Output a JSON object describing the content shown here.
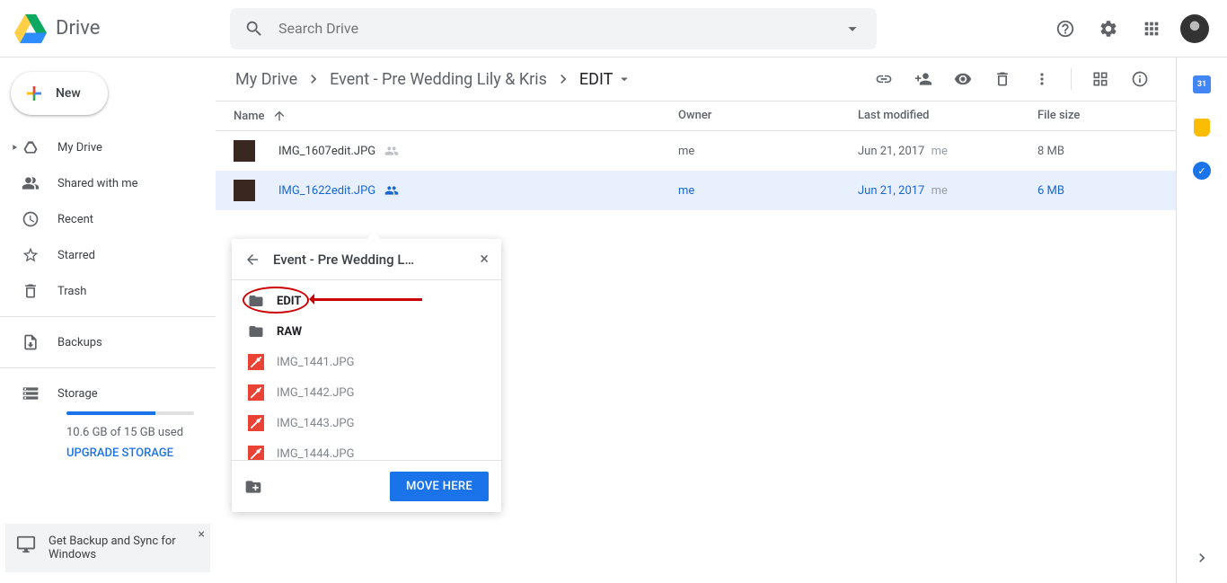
{
  "header": {
    "app_title": "Drive",
    "search_placeholder": "Search Drive"
  },
  "new_button": {
    "label": "New"
  },
  "sidebar": {
    "items": [
      {
        "label": "My Drive"
      },
      {
        "label": "Shared with me"
      },
      {
        "label": "Recent"
      },
      {
        "label": "Starred"
      },
      {
        "label": "Trash"
      }
    ],
    "backups_label": "Backups",
    "storage": {
      "label": "Storage",
      "used_text": "10.6 GB of 15 GB used",
      "upgrade_label": "UPGRADE STORAGE"
    },
    "promo_text": "Get Backup and Sync for Windows"
  },
  "breadcrumbs": {
    "root": "My Drive",
    "mid": "Event - Pre Wedding Lily & Kris",
    "current": "EDIT"
  },
  "columns": {
    "name": "Name",
    "owner": "Owner",
    "modified": "Last modified",
    "size": "File size"
  },
  "files": [
    {
      "name": "IMG_1607edit.JPG",
      "owner": "me",
      "modified": "Jun 21, 2017",
      "by": "me",
      "size": "8 MB",
      "selected": false
    },
    {
      "name": "IMG_1622edit.JPG",
      "owner": "me",
      "modified": "Jun 21, 2017",
      "by": "me",
      "size": "6 MB",
      "selected": true
    }
  ],
  "move_popup": {
    "title": "Event - Pre Wedding L…",
    "items": [
      {
        "label": "EDIT",
        "type": "folder",
        "bold": true
      },
      {
        "label": "RAW",
        "type": "folder",
        "bold": true
      },
      {
        "label": "IMG_1441.JPG",
        "type": "image"
      },
      {
        "label": "IMG_1442.JPG",
        "type": "image"
      },
      {
        "label": "IMG_1443.JPG",
        "type": "image"
      },
      {
        "label": "IMG_1444.JPG",
        "type": "image"
      }
    ],
    "button_label": "MOVE HERE"
  }
}
